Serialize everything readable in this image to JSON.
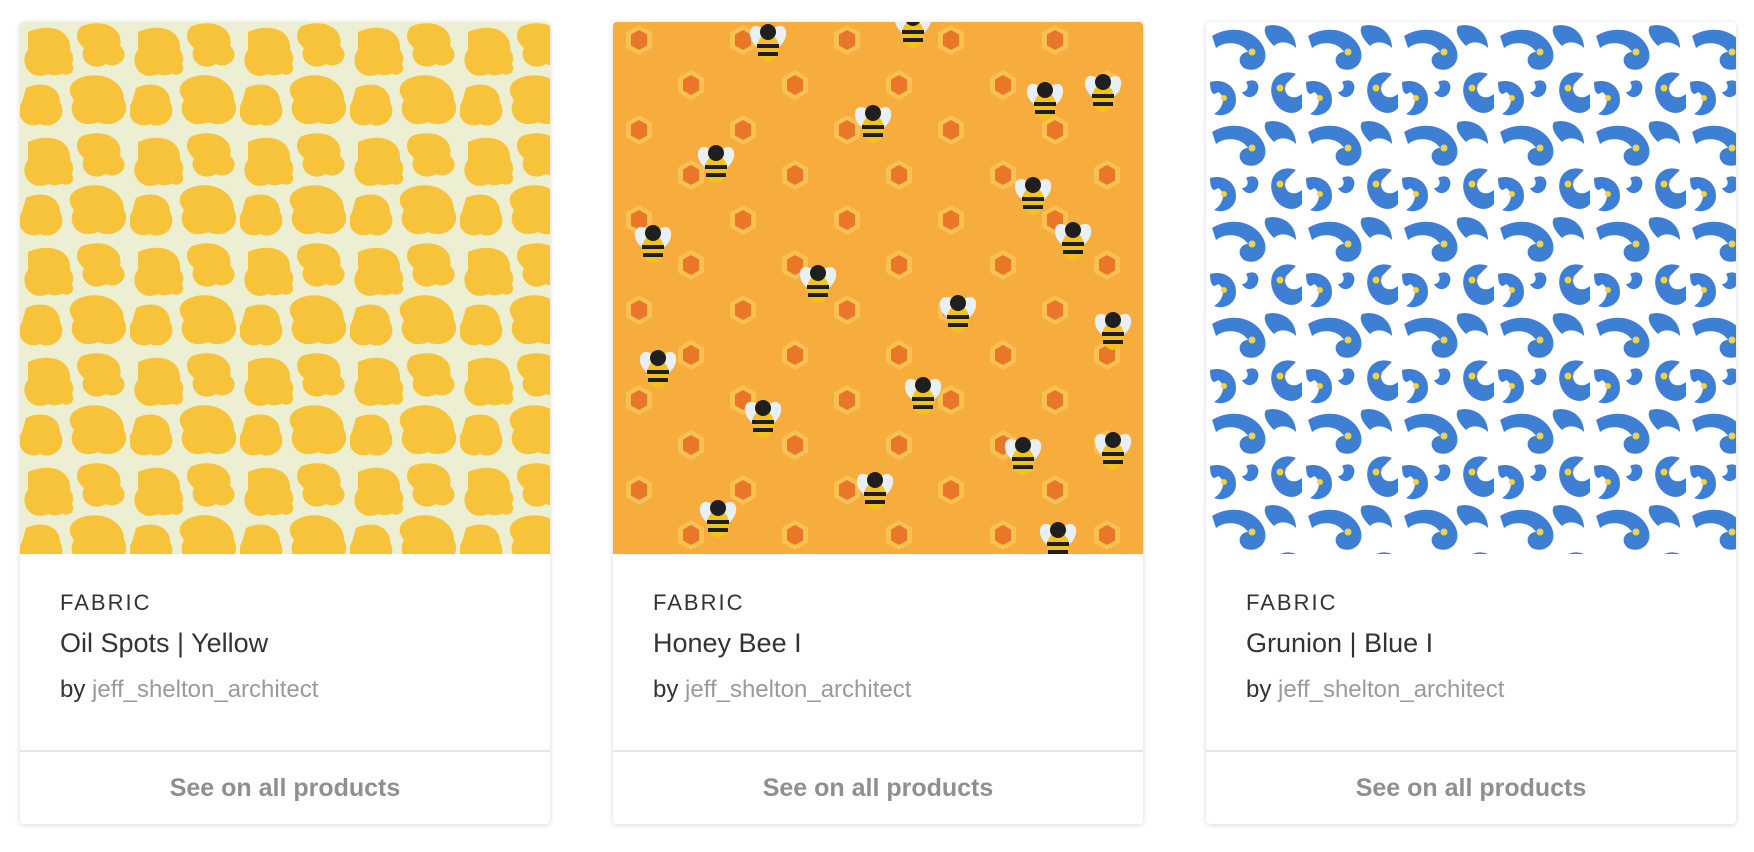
{
  "products": [
    {
      "type_label": "FABRIC",
      "title": "Oil Spots | Yellow",
      "by_prefix": "by",
      "author": "jeff_shelton_architect",
      "cta_label": "See on all products",
      "pattern": "oil-spots-yellow",
      "colors": {
        "primary": "#f6c33a",
        "background": "#ecefd2"
      }
    },
    {
      "type_label": "FABRIC",
      "title": "Honey Bee I",
      "by_prefix": "by",
      "author": "jeff_shelton_architect",
      "cta_label": "See on all products",
      "pattern": "honey-bee",
      "colors": {
        "primary": "#f7ad3e",
        "accent": "#e8772a",
        "bee": "#222222"
      }
    },
    {
      "type_label": "FABRIC",
      "title": "Grunion | Blue I",
      "by_prefix": "by",
      "author": "jeff_shelton_architect",
      "cta_label": "See on all products",
      "pattern": "grunion-blue",
      "colors": {
        "primary": "#3e7fd6",
        "background": "#ffffff",
        "accent": "#f4d23c"
      }
    }
  ]
}
